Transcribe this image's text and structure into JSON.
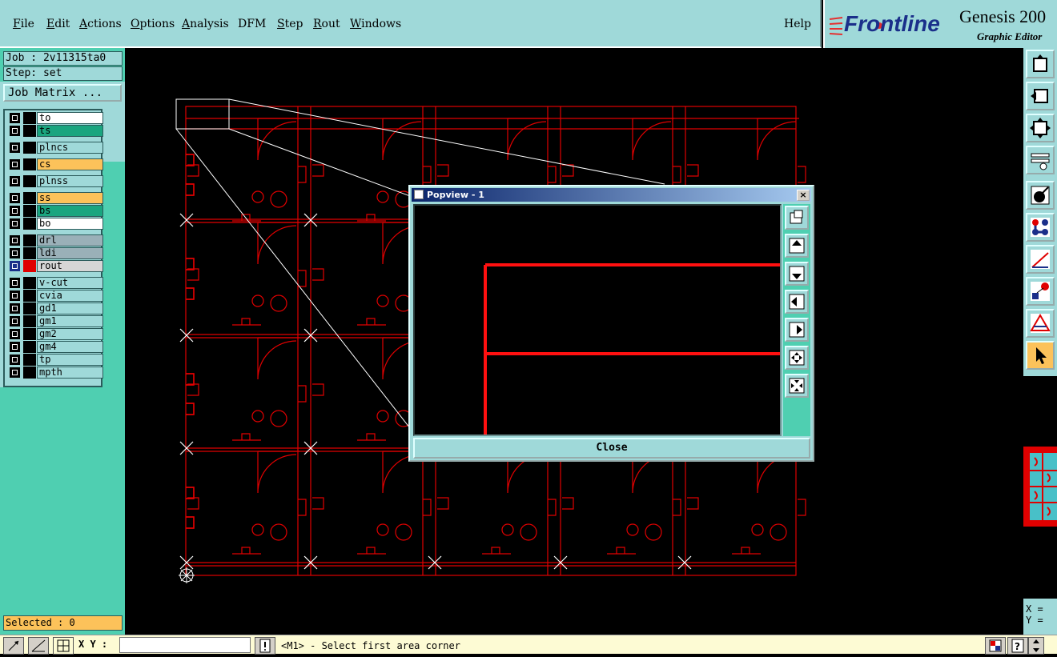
{
  "menu": {
    "items": [
      {
        "label": "File",
        "underline": "F",
        "rest": "ile"
      },
      {
        "label": "Edit",
        "underline": "E",
        "rest": "dit"
      },
      {
        "label": "Actions",
        "underline": "A",
        "rest": "ctions"
      },
      {
        "label": "Options",
        "underline": "O",
        "rest": "ptions"
      },
      {
        "label": "Analysis",
        "underline": "A",
        "rest": "nalysis"
      },
      {
        "label": "DFM",
        "underline": "",
        "rest": "DFM"
      },
      {
        "label": "Step",
        "underline": "S",
        "rest": "tep"
      },
      {
        "label": "Rout",
        "underline": "R",
        "rest": "out"
      },
      {
        "label": "Windows",
        "underline": "W",
        "rest": "indows"
      }
    ],
    "help": "Help"
  },
  "logo": {
    "brand": "Frontline",
    "product": "Genesis 200",
    "subtitle": "Graphic Editor"
  },
  "job": {
    "job_label": "Job : 2v11315ta0",
    "step_label": "Step: set",
    "matrix_button": "Job Matrix ..."
  },
  "layers": [
    {
      "name": "to",
      "color": "#ffffff"
    },
    {
      "name": "ts",
      "color": "#1aa57f"
    },
    {
      "name": "plncs",
      "color": "#9fd9d9"
    },
    {
      "name": "cs",
      "color": "#fcc25a"
    },
    {
      "name": "plnss",
      "color": "#9fd9d9"
    },
    {
      "name": "ss",
      "color": "#fcc25a"
    },
    {
      "name": "bs",
      "color": "#1aa57f"
    },
    {
      "name": "bo",
      "color": "#ffffff"
    },
    {
      "name": "drl",
      "color": "#9ab0b8"
    },
    {
      "name": "ldi",
      "color": "#9ab0b8"
    },
    {
      "name": "rout",
      "color": "#d6d6d6"
    },
    {
      "name": "v-cut",
      "color": "#9fd9d9"
    },
    {
      "name": "cvia",
      "color": "#9fd9d9"
    },
    {
      "name": "gd1",
      "color": "#9fd9d9"
    },
    {
      "name": "gm1",
      "color": "#9fd9d9"
    },
    {
      "name": "gm2",
      "color": "#9fd9d9"
    },
    {
      "name": "gm4",
      "color": "#9fd9d9"
    },
    {
      "name": "tp",
      "color": "#9fd9d9"
    },
    {
      "name": "mpth",
      "color": "#9fd9d9"
    }
  ],
  "selected_text": "Selected : 0",
  "popview": {
    "title": "Popview - 1",
    "close_x": "×",
    "close_button": "Close"
  },
  "coords": {
    "x": "X = ",
    "y": "Y = "
  },
  "statusbar": {
    "xy_label": "X Y :",
    "xy_value": "",
    "message": "<M1> - Select first area corner"
  },
  "colors": {
    "panel": "#9fd9d9",
    "panel_dark": "#4fcfb1",
    "rout_red": "#e00000"
  }
}
